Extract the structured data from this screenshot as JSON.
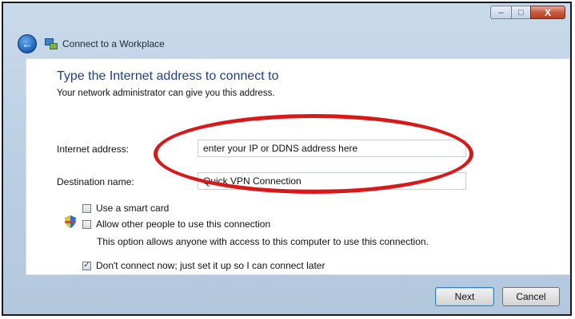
{
  "window": {
    "title": "Connect to a Workplace",
    "controls": {
      "minimize": "–",
      "maximize": "□",
      "close": "X"
    }
  },
  "page": {
    "heading": "Type the Internet address to connect to",
    "subtext": "Your network administrator can give you this address."
  },
  "fields": {
    "internet_address_label": "Internet address:",
    "internet_address_value": "enter your IP or DDNS address here",
    "destination_name_label": "Destination name:",
    "destination_name_value": "Quick VPN Connection"
  },
  "options": {
    "smart_card": {
      "label": "Use a smart card",
      "checked": false
    },
    "allow_others": {
      "label": "Allow other people to use this connection",
      "checked": false
    },
    "allow_others_note": "This option allows anyone with access to this computer to use this connection.",
    "dont_connect": {
      "label": "Don't connect now; just set it up so I can connect later",
      "checked": true
    },
    "check_mark": "✓"
  },
  "buttons": {
    "next": "Next",
    "cancel": "Cancel"
  },
  "icons": {
    "back": "back-arrow-icon",
    "wizard": "network-connection-icon",
    "shield": "uac-shield-icon"
  },
  "colors": {
    "heading": "#1e3f8f",
    "highlight_oval": "#d8191a"
  }
}
